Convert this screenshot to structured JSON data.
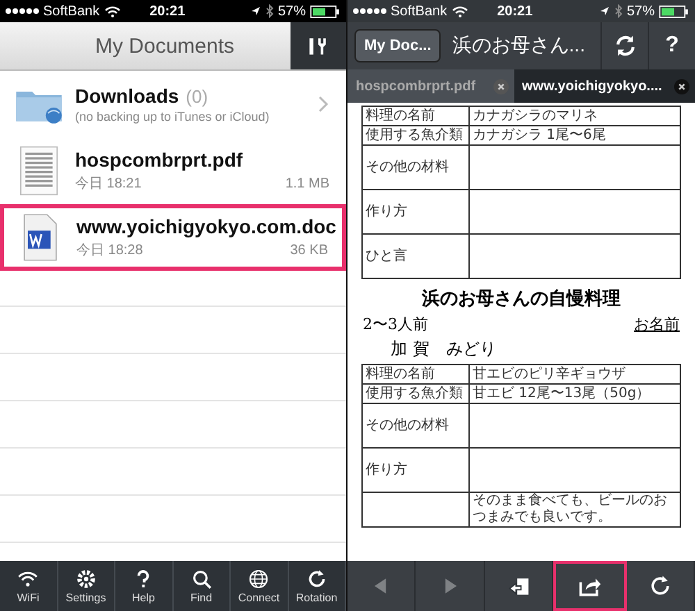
{
  "status_bars": [
    {
      "carrier": "SoftBank",
      "time": "20:21",
      "battery": "57%"
    },
    {
      "carrier": "SoftBank",
      "time": "20:21",
      "battery": "57%"
    }
  ],
  "documents_panel": {
    "title": "My Documents",
    "files": [
      {
        "kind": "folder",
        "name": "Downloads",
        "count": "(0)",
        "note": "(no backing up to iTunes or iCloud)",
        "selected": false
      },
      {
        "kind": "pdf",
        "name": "hospcombrprt.pdf",
        "date": "今日 18:21",
        "size": "1.1 MB",
        "selected": false
      },
      {
        "kind": "doc",
        "name": "www.yoichigyokyo.com.doc",
        "date": "今日 18:28",
        "size": "36 KB",
        "selected": true
      }
    ],
    "toolbar": [
      {
        "kind": "wifi",
        "label": "WiFi"
      },
      {
        "kind": "settings",
        "label": "Settings"
      },
      {
        "kind": "help",
        "label": "Help"
      },
      {
        "kind": "find",
        "label": "Find"
      },
      {
        "kind": "connect",
        "label": "Connect"
      },
      {
        "kind": "rotation",
        "label": "Rotation"
      }
    ]
  },
  "viewer_panel": {
    "back": "My Doc...",
    "title": "浜のお母さん...",
    "help": "?",
    "tabs": [
      {
        "label": "hospcombrprt.pdf",
        "selected": false
      },
      {
        "label": "www.yoichigyokyo....",
        "selected": true
      }
    ],
    "document": {
      "top_table": [
        {
          "label": "料理の名前",
          "text": "カナガシラのマリネ"
        },
        {
          "label": "使用する魚介類",
          "text": "カナガシラ 1尾〜6尾"
        },
        {
          "label": "その他の材料"
        },
        {
          "label": "作り方"
        },
        {
          "label": "ひと言"
        }
      ],
      "heading": "浜のお母さんの自慢料理",
      "servings": "2〜3人前",
      "name_label": "お名前",
      "author": "加 賀　みどり",
      "table": [
        {
          "label": "料理の名前",
          "text": "甘エビのピリ辛ギョウザ"
        },
        {
          "label": "使用する魚介類",
          "text": "甘エビ 12尾〜13尾（50g）"
        },
        {
          "label": "その他の材料"
        },
        {
          "label": "作り方"
        },
        {
          "text": "そのまま食べても、ビールのおつまみでも良いです。"
        }
      ]
    },
    "toolbar": [
      {
        "kind": "back",
        "disabled": true,
        "selected": false
      },
      {
        "kind": "forward",
        "disabled": true,
        "selected": false
      },
      {
        "kind": "undo",
        "disabled": false,
        "selected": false
      },
      {
        "kind": "share",
        "disabled": false,
        "selected": true
      },
      {
        "kind": "reload",
        "disabled": false,
        "selected": false
      }
    ]
  }
}
